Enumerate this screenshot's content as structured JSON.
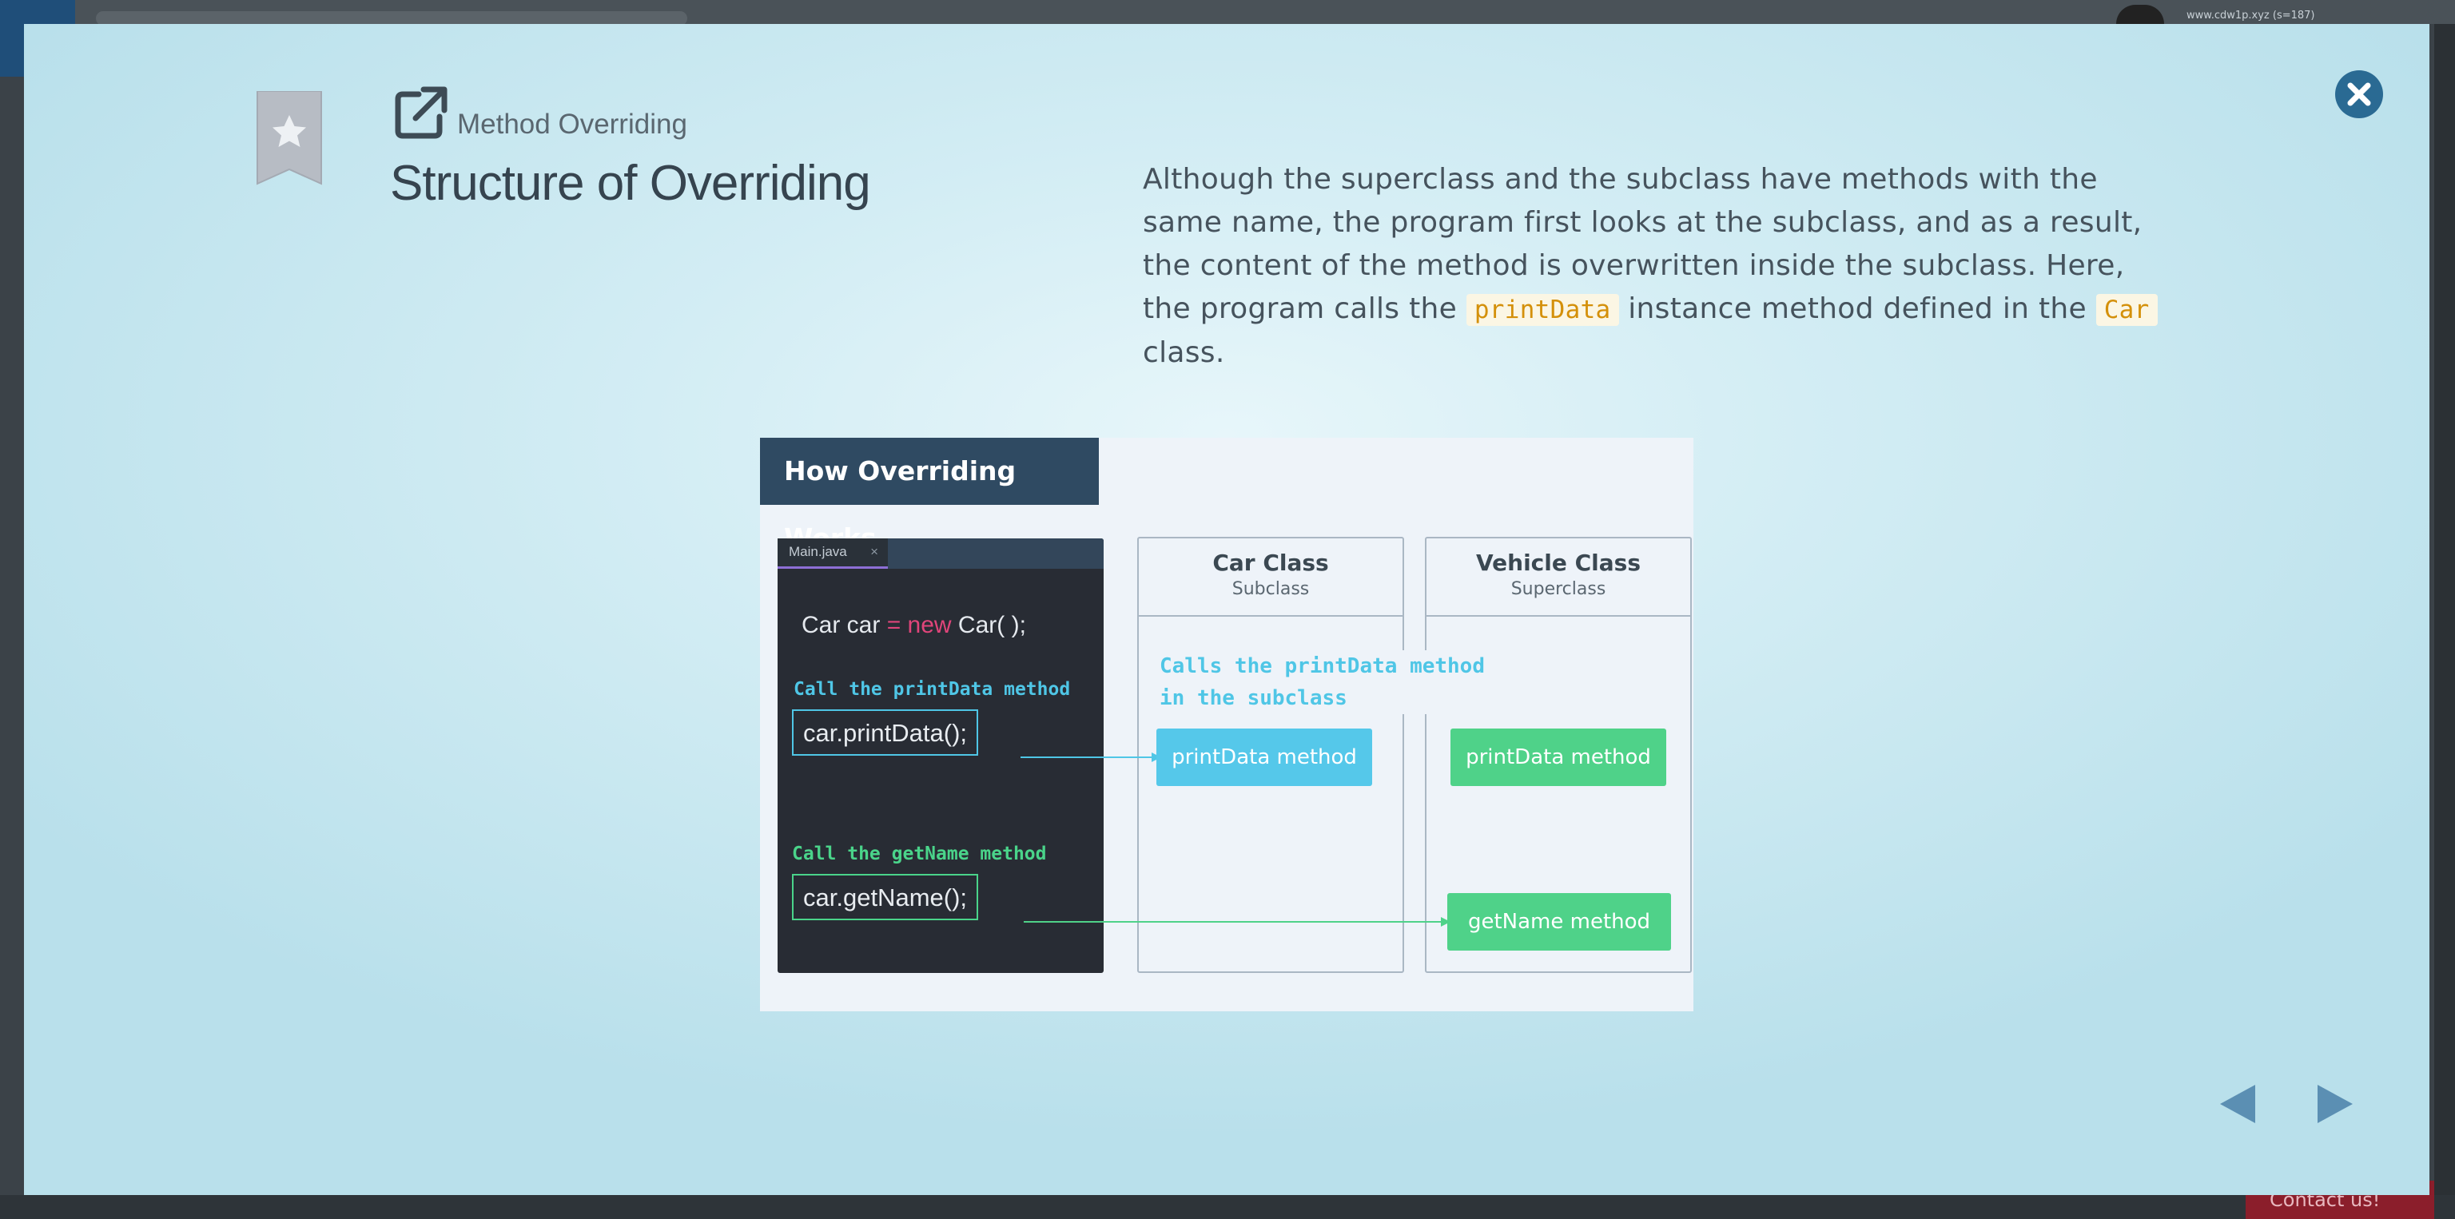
{
  "background": {
    "url_text": "www.cdw1p.xyz (s=187)",
    "contact_label": "Contact us!"
  },
  "slide": {
    "section_label": "Method Overriding",
    "title": "Structure of Overriding",
    "description": {
      "part1": "Although the superclass and the subclass have methods with the same name, the program first looks at the subclass, and as a result, the content of the method is overwritten inside the subclass. Here, the program calls the ",
      "code1": "printData",
      "part2": " instance method defined in the ",
      "code2": "Car",
      "part3": " class."
    }
  },
  "diagram": {
    "header": "How Overriding Works",
    "editor": {
      "tab_label": "Main.java",
      "tab_close": "×",
      "code_line": {
        "prefix": "Car car ",
        "op": "=",
        "keyword": " new",
        "suffix": " Car( );"
      },
      "comment_print": "Call the printData method",
      "call_print": "car.printData();",
      "comment_name": "Call the getName method",
      "call_name": "car.getName();"
    },
    "car_column": {
      "title": "Car Class",
      "subtitle": "Subclass"
    },
    "vehicle_column": {
      "title": "Vehicle Class",
      "subtitle": "Superclass"
    },
    "arrow_note_line1": "Calls the printData method",
    "arrow_note_line2": "in the subclass",
    "car_method": "printData method",
    "vehicle_print_method": "printData method",
    "vehicle_name_method": "getName method"
  },
  "colors": {
    "accent_blue": "#55c8ea",
    "accent_green": "#4fd289",
    "header_navy": "#2f4a62",
    "close_button": "#2a6a93",
    "nav_arrows": "#5b8fb3"
  },
  "icons": {
    "bookmark": "bookmark-star-icon",
    "open": "external-link-icon",
    "close": "close-icon",
    "prev": "arrow-left-icon",
    "next": "arrow-right-icon"
  }
}
